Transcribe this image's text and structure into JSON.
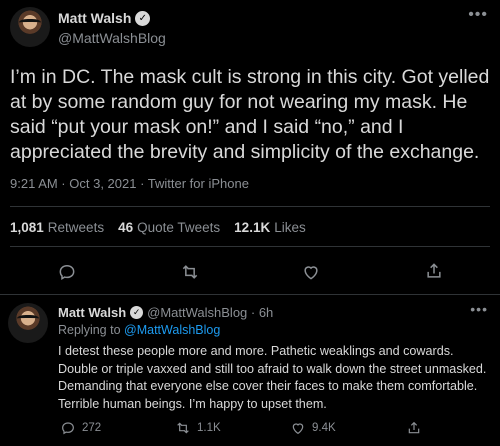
{
  "main_tweet": {
    "display_name": "Matt Walsh",
    "handle": "@MattWalshBlog",
    "text": "I’m in DC. The mask cult is strong in this city. Got yelled at by some random guy for not wearing my mask. He said “put your mask on!” and I said “no,” and I appreciated the brevity and simplicity of the exchange.",
    "meta": "9:21 AM · Oct 3, 2021 · Twitter for iPhone",
    "stats": {
      "retweets_count": "1,081",
      "retweets_label": "Retweets",
      "quotes_count": "46",
      "quotes_label": "Quote Tweets",
      "likes_count": "12.1K",
      "likes_label": "Likes"
    },
    "icons": [
      "reply-icon",
      "retweet-icon",
      "like-icon",
      "share-icon"
    ]
  },
  "reply_tweet": {
    "display_name": "Matt Walsh",
    "handle_time": "@MattWalshBlog · 6h",
    "replying_prefix": "Replying to",
    "replying_to": "@MattWalshBlog",
    "text": "I detest these people more and more. Pathetic weaklings and cowards. Double or triple vaxxed and still too afraid to walk down the street unmasked. Demanding that everyone else cover their faces to make them comfortable. Terrible human beings. I’m happy to upset them.",
    "reply_count": "272",
    "retweet_count": "1.1K",
    "like_count": "9.4K"
  },
  "colors": {
    "background": "#000000",
    "text": "#d9d9d9",
    "muted": "#8b8f94",
    "link": "#1d9bf0",
    "divider": "#2f3336"
  }
}
